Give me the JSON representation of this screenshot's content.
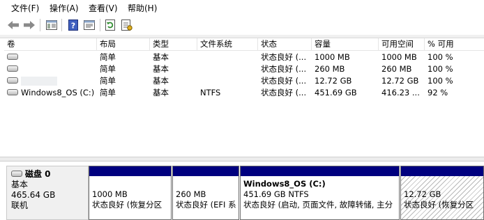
{
  "menu": [
    "文件(F)",
    "操作(A)",
    "查看(V)",
    "帮助(H)"
  ],
  "toolbar": {
    "icons": [
      "back-arrow-icon",
      "forward-arrow-icon",
      "console-tree-icon",
      "help-icon",
      "properties-icon",
      "refresh-icon",
      "rescan-disks-icon"
    ]
  },
  "volume_list": {
    "columns": [
      "卷",
      "布局",
      "类型",
      "文件系统",
      "状态",
      "容量",
      "可用空间",
      "% 可用"
    ],
    "rows": [
      {
        "volume": "",
        "layout": "简单",
        "type": "基本",
        "fs": "",
        "status": "状态良好 (...",
        "capacity": "1000 MB",
        "free": "1000 MB",
        "pct": "100 %"
      },
      {
        "volume": "",
        "layout": "简单",
        "type": "基本",
        "fs": "",
        "status": "状态良好 (...",
        "capacity": "260 MB",
        "free": "260 MB",
        "pct": "100 %"
      },
      {
        "volume": "",
        "layout": "简单",
        "type": "基本",
        "fs": "",
        "status": "状态良好 (...",
        "capacity": "12.72 GB",
        "free": "12.72 GB",
        "pct": "100 %"
      },
      {
        "volume": "Windows8_OS (C:)",
        "layout": "简单",
        "type": "基本",
        "fs": "NTFS",
        "status": "状态良好 (...",
        "capacity": "451.69 GB",
        "free": "416.23 ...",
        "pct": "92 %"
      }
    ]
  },
  "disk0": {
    "title": "磁盘 0",
    "type": "基本",
    "size": "465.64 GB",
    "state": "联机",
    "partitions": [
      {
        "line1": "",
        "line2": "1000 MB",
        "line3": "状态良好 (恢复分区"
      },
      {
        "line1": "",
        "line2": "260 MB",
        "line3": "状态良好 (EFI 系"
      },
      {
        "line1": "Windows8_OS  (C:)",
        "line2": "451.69 GB NTFS",
        "line3": "状态良好 (启动, 页面文件, 故障转储, 主分"
      },
      {
        "line1": "",
        "line2": "12.72 GB",
        "line3": "状态良好 (恢复分区"
      }
    ]
  }
}
